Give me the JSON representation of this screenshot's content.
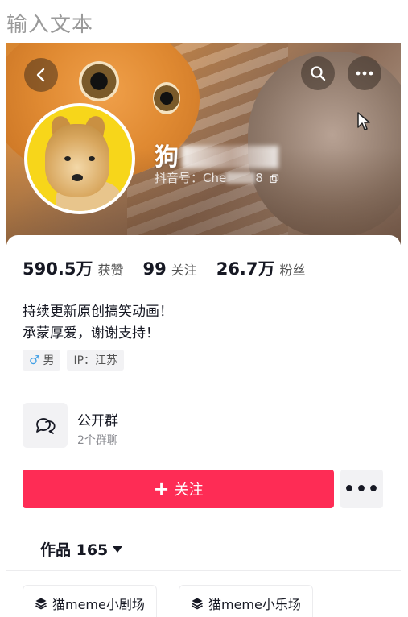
{
  "top_caption": "输入文本",
  "header": {
    "icons": {
      "back": "back-arrow-icon",
      "search": "search-icon",
      "more": "more-dots-icon"
    }
  },
  "profile": {
    "nickname": "狗",
    "douyin_id_label": "抖音号：",
    "douyin_id_prefix": "Che",
    "douyin_id_suffix": "8"
  },
  "stats": [
    {
      "value": "590.5万",
      "label": "获赞"
    },
    {
      "value": "99",
      "label": "关注"
    },
    {
      "value": "26.7万",
      "label": "粉丝"
    }
  ],
  "bio": {
    "line1": "持续更新原创搞笑动画！",
    "line2": "承蒙厚爱，谢谢支持！"
  },
  "tags": {
    "gender_symbol": "♂",
    "gender": "男",
    "ip": "IP：江苏"
  },
  "group": {
    "title": "公开群",
    "subtitle": "2个群聊"
  },
  "actions": {
    "follow_plus": "+",
    "follow_label": "关注",
    "more_label": "•••"
  },
  "works": {
    "tab_label": "作品 165"
  },
  "collections": [
    {
      "label": "猫meme小剧场"
    },
    {
      "label": "猫meme小乐场"
    }
  ],
  "colors": {
    "accent": "#fe2c55",
    "male": "#3f9fe5",
    "avatar_bg": "#f7d61a"
  }
}
